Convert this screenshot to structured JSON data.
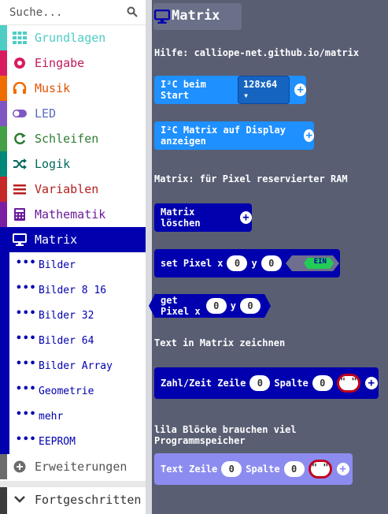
{
  "search": {
    "placeholder": "Suche..."
  },
  "categories": [
    {
      "label": "Grundlagen",
      "color": "#1e90ff",
      "bar": "#4ecdc4",
      "icon": "grid-icon"
    },
    {
      "label": "Eingabe",
      "color": "#c2185b",
      "bar": "#d81b60",
      "icon": "radio-icon"
    },
    {
      "label": "Musik",
      "color": "#e65100",
      "bar": "#ef6c00",
      "icon": "headphones-icon"
    },
    {
      "label": "LED",
      "color": "#5c6bc0",
      "bar": "#7e57c2",
      "icon": "toggle-icon"
    },
    {
      "label": "Schleifen",
      "color": "#2e7d32",
      "bar": "#43a047",
      "icon": "loop-icon"
    },
    {
      "label": "Logik",
      "color": "#00695c",
      "bar": "#00897b",
      "icon": "shuffle-icon"
    },
    {
      "label": "Variablen",
      "color": "#b71c1c",
      "bar": "#c62828",
      "icon": "list-icon"
    },
    {
      "label": "Mathematik",
      "color": "#6a1b9a",
      "bar": "#7b1fa2",
      "icon": "calculator-icon"
    },
    {
      "label": "Matrix",
      "color": "#ffffff",
      "bar": "#0000ae",
      "icon": "monitor-icon"
    }
  ],
  "subcategories": [
    {
      "label": "Bilder"
    },
    {
      "label": "Bilder 8 16"
    },
    {
      "label": "Bilder 32"
    },
    {
      "label": "Bilder 64"
    },
    {
      "label": "Bilder Array"
    },
    {
      "label": "Geometrie"
    },
    {
      "label": "mehr"
    },
    {
      "label": "EEPROM"
    }
  ],
  "extensions": {
    "label": "Erweiterungen"
  },
  "advanced": {
    "label": "Fortgeschritten"
  },
  "flyout": {
    "title": "Matrix",
    "help": "Hilfe: calliope-net.github.io/matrix",
    "block_i2c_start": "I²C beim Start",
    "dropdown_value": "128x64 ▾",
    "block_i2c_display": "I²C Matrix auf Display anzeigen",
    "label_ram": "Matrix: für Pixel reservierter RAM",
    "block_clear": "Matrix löschen",
    "block_set_pixel": "set Pixel x",
    "block_set_pixel_y": "y",
    "set_x": "0",
    "set_y": "0",
    "toggle_on": "EIN",
    "block_get_pixel": "get Pixel x",
    "block_get_pixel_y": "y",
    "get_x": "0",
    "get_y": "0",
    "label_text": "Text in Matrix zeichnen",
    "block_number": "Zahl/Zeit Zeile",
    "num_row": "0",
    "num_col_label": "Spalte",
    "num_col": "0",
    "quote": "\" \"",
    "label_purple": "lila Blöcke brauchen viel Programmspeicher",
    "block_text": "Text Zeile",
    "text_row": "0",
    "text_col_label": "Spalte",
    "text_col": "0"
  }
}
